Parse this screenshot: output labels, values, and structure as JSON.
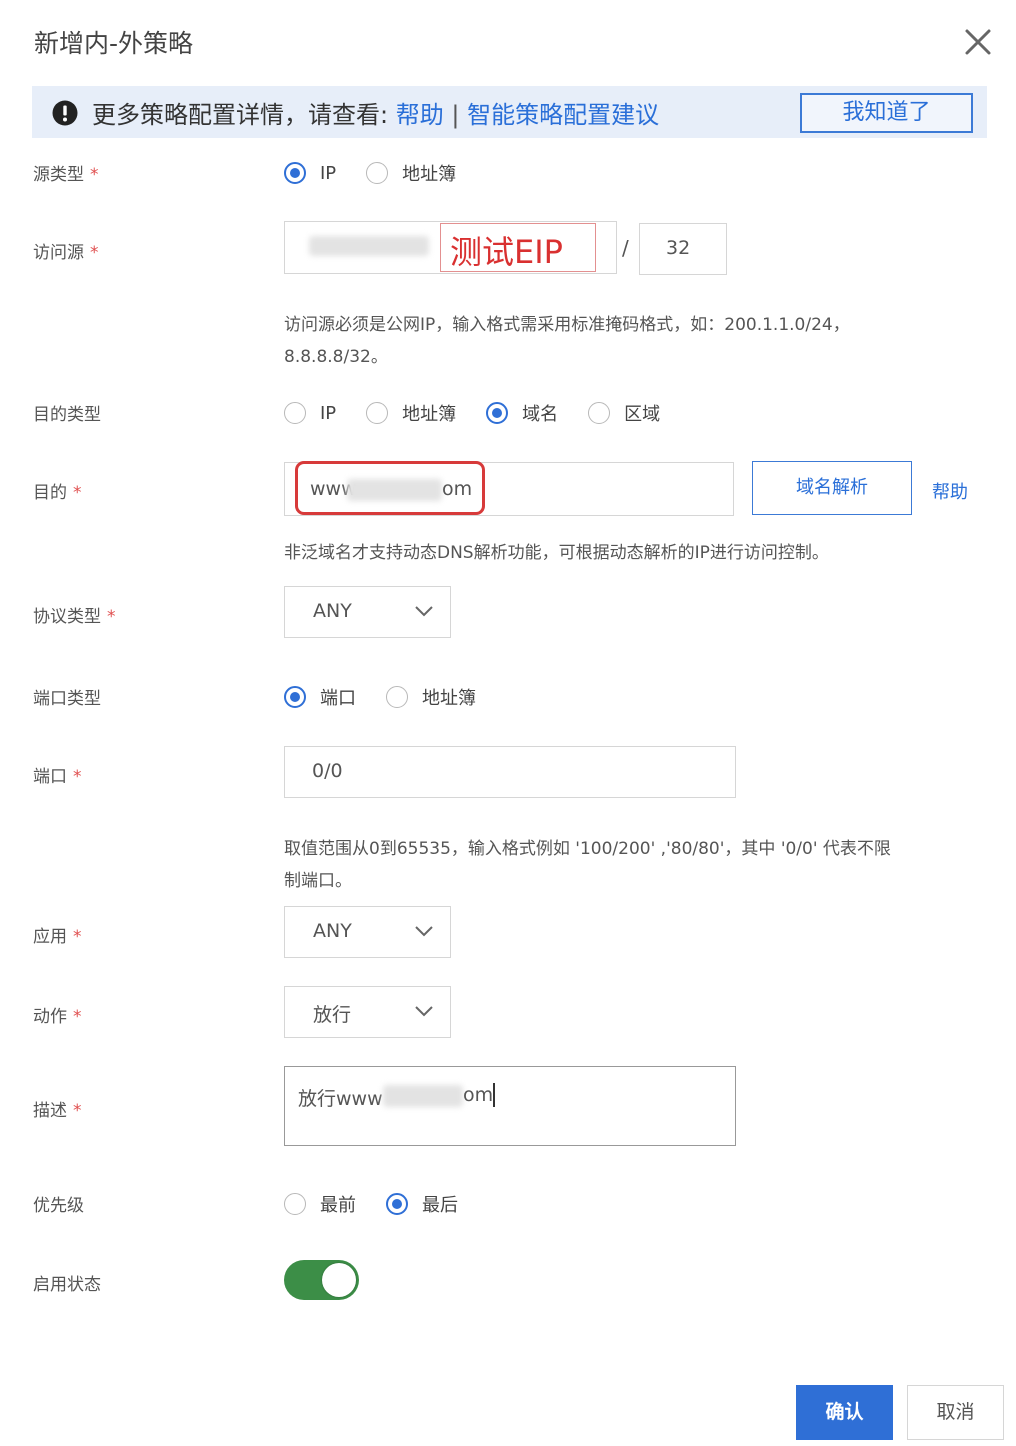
{
  "dialog": {
    "title": "新增内-外策略"
  },
  "banner": {
    "text": "更多策略配置详情，请查看:",
    "help_link": "帮助",
    "separator": "|",
    "suggest_link": "智能策略配置建议",
    "ack_button": "我知道了"
  },
  "fields": {
    "source_type": {
      "label": "源类型",
      "required": "*",
      "options": [
        "IP",
        "地址簿"
      ],
      "selected": "IP"
    },
    "source": {
      "label": "访问源",
      "required": "*",
      "annotation": "测试EIP",
      "slash": "/",
      "mask": "32",
      "hint_line1": "访问源必须是公网IP，输入格式需采用标准掩码格式，如：200.1.1.0/24，",
      "hint_line2": "8.8.8.8/32。"
    },
    "dest_type": {
      "label": "目的类型",
      "options": [
        "IP",
        "地址簿",
        "域名",
        "区域"
      ],
      "selected": "域名"
    },
    "dest": {
      "label": "目的",
      "required": "*",
      "value_prefix": "www",
      "value_suffix": "om",
      "resolve_button": "域名解析",
      "help_link": "帮助",
      "hint": "非泛域名才支持动态DNS解析功能，可根据动态解析的IP进行访问控制。"
    },
    "protocol": {
      "label": "协议类型",
      "required": "*",
      "value": "ANY"
    },
    "port_type": {
      "label": "端口类型",
      "options": [
        "端口",
        "地址簿"
      ],
      "selected": "端口"
    },
    "port": {
      "label": "端口",
      "required": "*",
      "value": "0/0",
      "hint_line1": "取值范围从0到65535，输入格式例如 '100/200' ,'80/80'，其中 '0/0' 代表不限",
      "hint_line2": "制端口。"
    },
    "application": {
      "label": "应用",
      "required": "*",
      "value": "ANY"
    },
    "action": {
      "label": "动作",
      "required": "*",
      "value": "放行"
    },
    "description": {
      "label": "描述",
      "required": "*",
      "value_prefix": "放行www",
      "value_suffix": "om"
    },
    "priority": {
      "label": "优先级",
      "options": [
        "最前",
        "最后"
      ],
      "selected": "最后"
    },
    "status": {
      "label": "启用状态",
      "enabled": true
    }
  },
  "footer": {
    "confirm": "确认",
    "cancel": "取消"
  },
  "colors": {
    "primary": "#2f6fd6",
    "banner_bg": "#e7eef9",
    "toggle_on": "#3c8e47",
    "annotation_red": "#d93030",
    "required": "#e05050"
  }
}
